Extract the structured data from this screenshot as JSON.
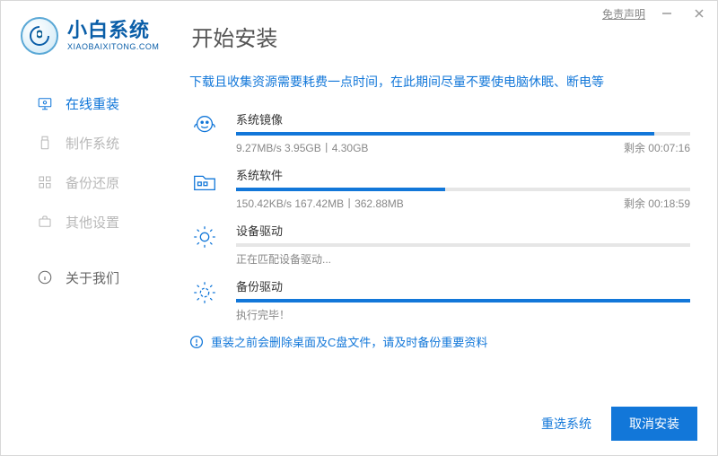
{
  "titlebar": {
    "disclaimer": "免责声明"
  },
  "brand": {
    "cn": "小白系统",
    "en": "XIAOBAIXITONG.COM"
  },
  "page_title": "开始安装",
  "sidebar": {
    "items": [
      {
        "label": "在线重装"
      },
      {
        "label": "制作系统"
      },
      {
        "label": "备份还原"
      },
      {
        "label": "其他设置"
      },
      {
        "label": "关于我们"
      }
    ]
  },
  "notice": "下载且收集资源需要耗费一点时间，在此期间尽量不要使电脑休眠、断电等",
  "tasks": [
    {
      "title": "系统镜像",
      "progress": 92,
      "detail": "9.27MB/s 3.95GB丨4.30GB",
      "remain": "剩余 00:07:16"
    },
    {
      "title": "系统软件",
      "progress": 46,
      "detail": "150.42KB/s 167.42MB丨362.88MB",
      "remain": "剩余 00:18:59"
    },
    {
      "title": "设备驱动",
      "progress": 0,
      "status": "正在匹配设备驱动..."
    },
    {
      "title": "备份驱动",
      "progress": 100,
      "status": "执行完毕！"
    }
  ],
  "warn": "重装之前会删除桌面及C盘文件，请及时备份重要资料",
  "footer": {
    "reselect": "重选系统",
    "cancel": "取消安装"
  }
}
